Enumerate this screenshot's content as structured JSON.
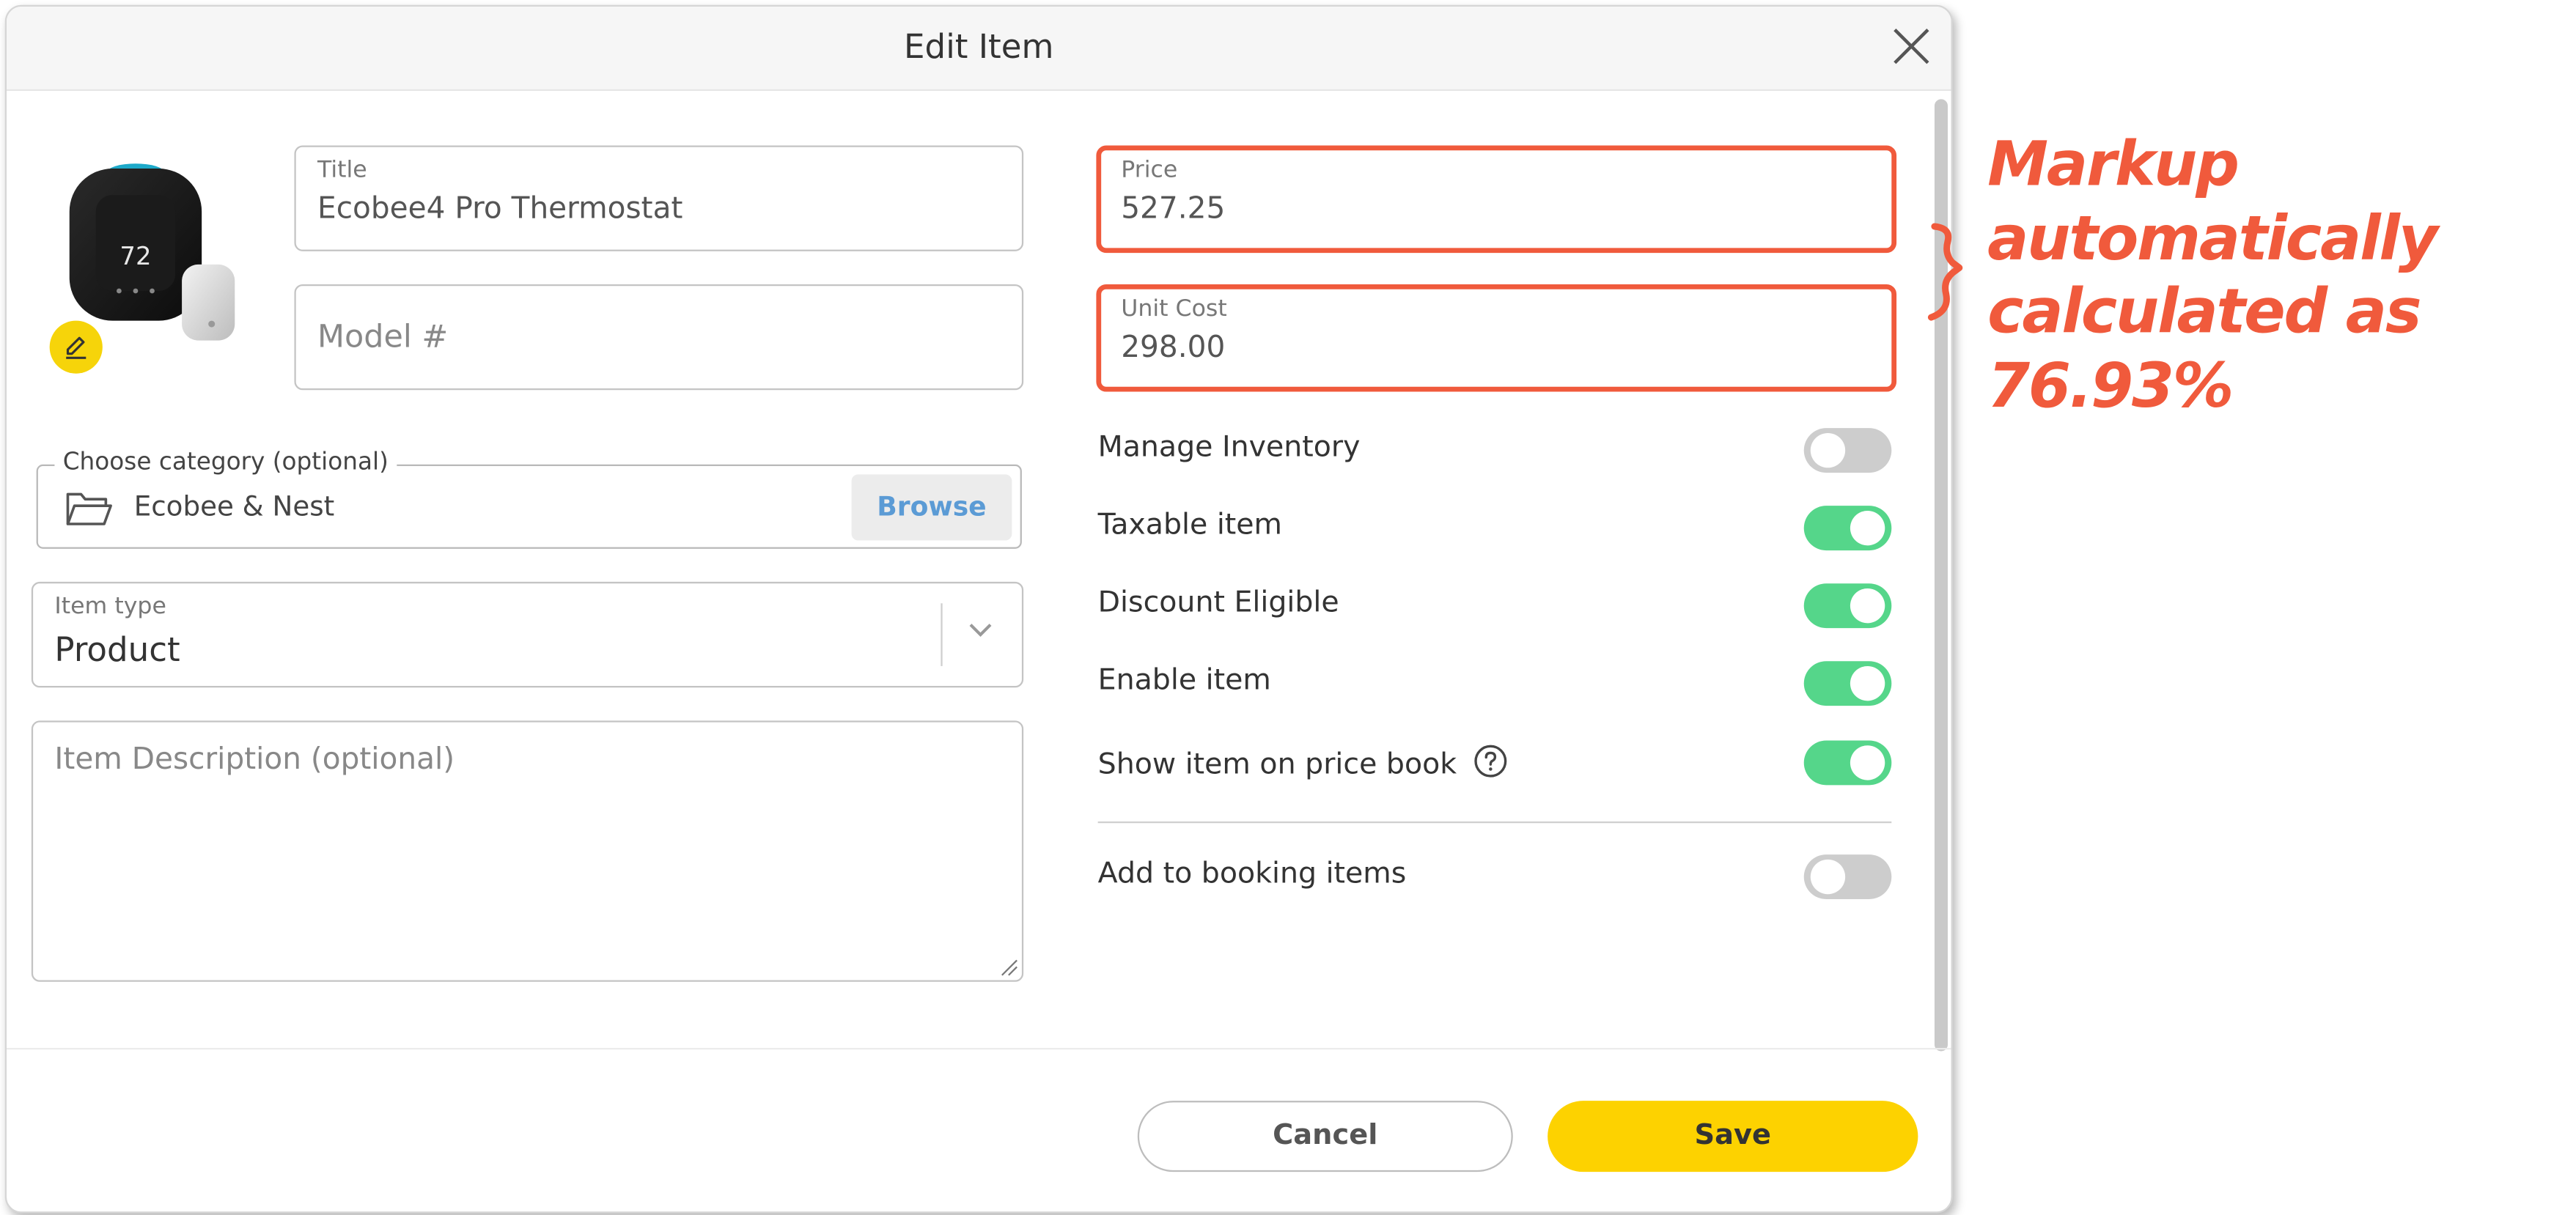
{
  "dialog": {
    "title": "Edit Item",
    "close_icon": "close-icon"
  },
  "product_image": {
    "description": "Ecobee4 thermostat with sensor",
    "display_temp": "72",
    "edit_icon": "pencil-icon",
    "edit_badge_color": "#f6d40a"
  },
  "fields": {
    "title": {
      "label": "Title",
      "value": "Ecobee4 Pro Thermostat"
    },
    "model": {
      "placeholder": "Model #"
    },
    "category": {
      "legend": "Choose category (optional)",
      "value": "Ecobee & Nest",
      "icon": "folder-icon",
      "browse_label": "Browse"
    },
    "item_type": {
      "label": "Item type",
      "value": "Product",
      "icon": "chevron-down-icon"
    },
    "description": {
      "placeholder": "Item Description (optional)"
    },
    "price": {
      "label": "Price",
      "value": "527.25"
    },
    "unit_cost": {
      "label": "Unit Cost",
      "value": "298.00"
    }
  },
  "toggles": [
    {
      "label": "Manage Inventory",
      "on": false
    },
    {
      "label": "Taxable item",
      "on": true
    },
    {
      "label": "Discount Eligible",
      "on": true
    },
    {
      "label": "Enable item",
      "on": true
    },
    {
      "label": "Show item on price book",
      "on": true,
      "help_icon": "question-circle-icon"
    },
    {
      "label": "Add to booking items",
      "on": false
    }
  ],
  "footer": {
    "cancel_label": "Cancel",
    "save_label": "Save"
  },
  "annotation": {
    "lines": [
      "Markup",
      "automatically",
      "calculated as",
      "76.93%"
    ],
    "color": "#f05a3c"
  },
  "colors": {
    "toggle_on": "#55d68a",
    "toggle_off": "#cdcdcd",
    "save_button": "#fdd200",
    "browse_text": "#5b9bd5",
    "highlight_border": "#f05a3c"
  }
}
